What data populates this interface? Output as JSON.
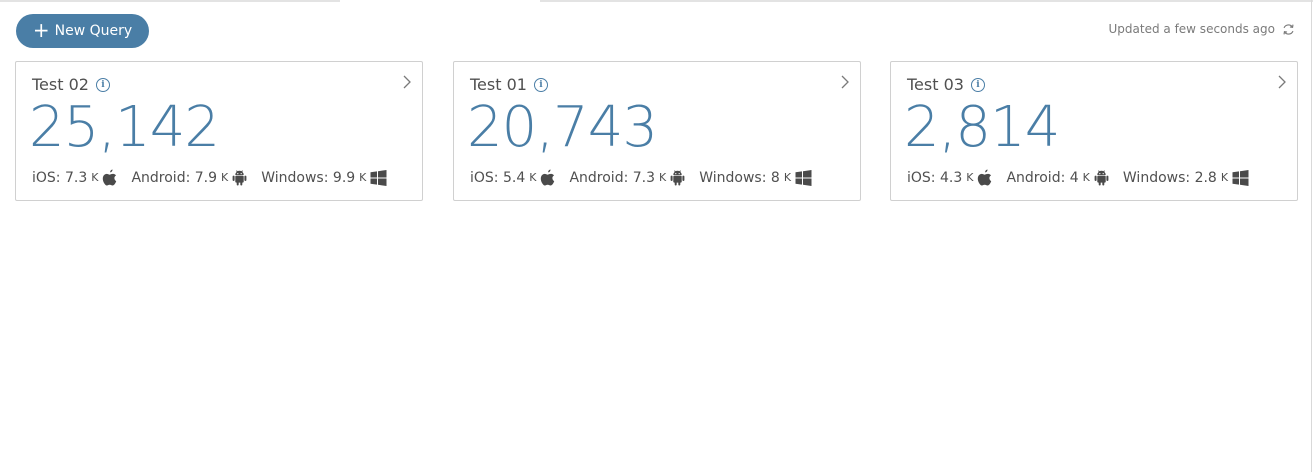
{
  "toolbar": {
    "new_query_label": "New Query",
    "updated_text": "Updated a few seconds ago"
  },
  "cards": [
    {
      "title": "Test 02",
      "total": "25,142",
      "ios_label": "iOS:",
      "ios_value": "7.3",
      "ios_unit": "K",
      "android_label": "Android:",
      "android_value": "7.9",
      "android_unit": "K",
      "windows_label": "Windows:",
      "windows_value": "9.9",
      "windows_unit": "K"
    },
    {
      "title": "Test 01",
      "total": "20,743",
      "ios_label": "iOS:",
      "ios_value": "5.4",
      "ios_unit": "K",
      "android_label": "Android:",
      "android_value": "7.3",
      "android_unit": "K",
      "windows_label": "Windows:",
      "windows_value": "8",
      "windows_unit": "K"
    },
    {
      "title": "Test 03",
      "total": "2,814",
      "ios_label": "iOS:",
      "ios_value": "4.3",
      "ios_unit": "K",
      "android_label": "Android:",
      "android_value": "4",
      "android_unit": "K",
      "windows_label": "Windows:",
      "windows_value": "2.8",
      "windows_unit": "K"
    }
  ],
  "icons": {
    "add": "plus-icon",
    "refresh": "refresh-icon",
    "info": "info-icon",
    "open": "chevron-right-icon",
    "ios": "apple-icon",
    "android": "android-icon",
    "windows": "windows-icon"
  },
  "colors": {
    "accent": "#4a7ea6",
    "text": "#505050",
    "muted": "#7a7a7a",
    "border": "#d0d0d0"
  }
}
